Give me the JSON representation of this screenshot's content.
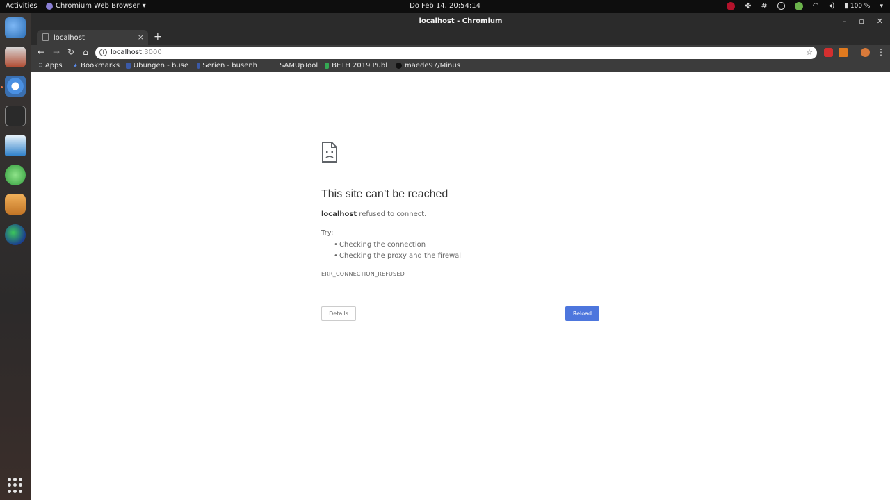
{
  "topbar": {
    "activities": "Activities",
    "app_name": "Chromium Web Browser",
    "clock": "Do Feb 14, 20:54:14",
    "battery": "100 %"
  },
  "window": {
    "title": "localhost - Chromium"
  },
  "tab": {
    "label": "localhost"
  },
  "omnibox": {
    "host": "localhost",
    "port": ":3000"
  },
  "bookmarks": [
    {
      "label": "Apps",
      "color": "#9aa0a6"
    },
    {
      "label": "Bookmarks",
      "color": "#5b8def"
    },
    {
      "label": "Übungen - buse",
      "color": "#3b5aa8"
    },
    {
      "label": "Serien - busenh",
      "color": "#3b5aa8"
    },
    {
      "label": "SAMUpTool",
      "color": "#3c3c3c"
    },
    {
      "label": "BETH 2019 Publ",
      "color": "#34a853"
    },
    {
      "label": "maede97/Minus",
      "color": "#111111"
    }
  ],
  "error": {
    "title": "This site can’t be reached",
    "host": "localhost",
    "message": " refused to connect.",
    "try_label": "Try:",
    "suggestions": [
      "Checking the connection",
      "Checking the proxy and the firewall"
    ],
    "code": "ERR_CONNECTION_REFUSED",
    "details_label": "Details",
    "reload_label": "Reload"
  },
  "colors": {
    "reload_button": "#4d76dd",
    "dock_active": "#f07746"
  }
}
